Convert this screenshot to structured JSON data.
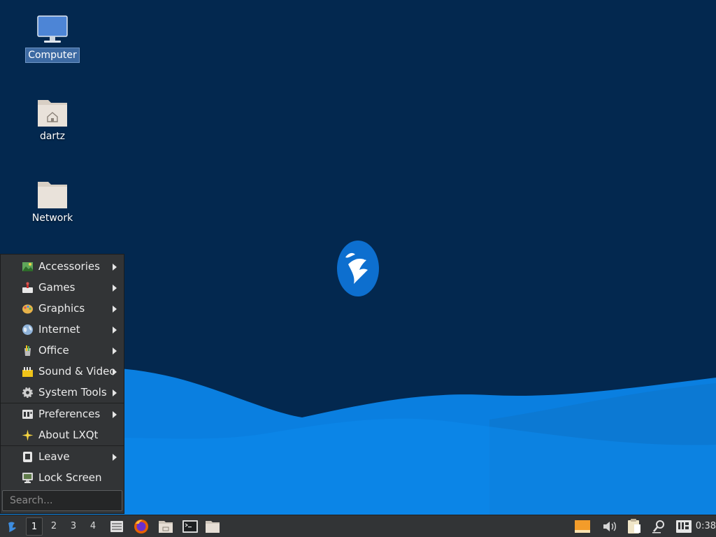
{
  "desktop": {
    "icons": [
      {
        "label": "Computer",
        "icon": "computer-icon",
        "selected": true
      },
      {
        "label": "dartz",
        "icon": "home-folder-icon",
        "selected": false
      },
      {
        "label": "Network",
        "icon": "folder-icon",
        "selected": false
      }
    ],
    "background_color": "#03284f",
    "wave_color": "#0b85e6",
    "logo": "lubuntu-bird-logo"
  },
  "start_menu": {
    "items": [
      {
        "label": "Accessories",
        "icon": "accessories-icon",
        "submenu": true
      },
      {
        "label": "Games",
        "icon": "games-icon",
        "submenu": true
      },
      {
        "label": "Graphics",
        "icon": "graphics-icon",
        "submenu": true
      },
      {
        "label": "Internet",
        "icon": "internet-globe-icon",
        "submenu": true
      },
      {
        "label": "Office",
        "icon": "office-icon",
        "submenu": true
      },
      {
        "label": "Sound & Video",
        "icon": "sound-video-icon",
        "submenu": true
      },
      {
        "label": "System Tools",
        "icon": "gear-icon",
        "submenu": true
      },
      {
        "label": "Preferences",
        "icon": "preferences-icon",
        "submenu": true
      },
      {
        "label": "About LXQt",
        "icon": "star-icon",
        "submenu": false
      },
      {
        "label": "Leave",
        "icon": "leave-icon",
        "submenu": true
      },
      {
        "label": "Lock Screen",
        "icon": "lock-screen-icon",
        "submenu": false
      }
    ],
    "search": {
      "placeholder": "Search...",
      "value": ""
    }
  },
  "taskbar": {
    "start_button_icon": "lubuntu-start-icon",
    "desktops": [
      "1",
      "2",
      "3",
      "4"
    ],
    "active_desktop": "1",
    "quicklaunch": [
      {
        "icon": "show-desktop-icon"
      },
      {
        "icon": "firefox-icon"
      },
      {
        "icon": "file-manager-icon"
      },
      {
        "icon": "terminal-icon"
      },
      {
        "icon": "folder-icon"
      }
    ],
    "tray": [
      {
        "icon": "window-indicator-icon"
      },
      {
        "icon": "volume-icon"
      },
      {
        "icon": "clipboard-icon"
      },
      {
        "icon": "search-tray-icon"
      },
      {
        "icon": "keyboard-layout-icon"
      }
    ],
    "clock": "0:38"
  }
}
